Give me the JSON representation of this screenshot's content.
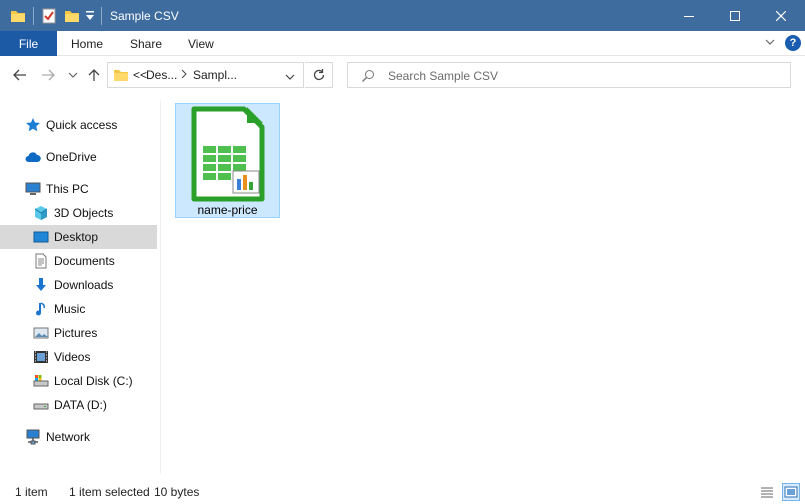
{
  "window": {
    "title": "Sample CSV"
  },
  "ribbon": {
    "tabs": [
      "File",
      "Home",
      "Share",
      "View"
    ]
  },
  "address": {
    "overflow": "<<",
    "segments": [
      "Des...",
      "Sampl..."
    ]
  },
  "search": {
    "placeholder": "Search Sample CSV"
  },
  "sidebar": {
    "items": [
      {
        "label": "Quick access",
        "icon": "star-icon"
      },
      {
        "label": "OneDrive",
        "icon": "cloud-icon"
      },
      {
        "label": "This PC",
        "icon": "computer-icon"
      },
      {
        "label": "3D Objects",
        "icon": "cube-icon"
      },
      {
        "label": "Desktop",
        "icon": "desktop-icon",
        "selected": true
      },
      {
        "label": "Documents",
        "icon": "document-icon"
      },
      {
        "label": "Downloads",
        "icon": "download-icon"
      },
      {
        "label": "Music",
        "icon": "music-icon"
      },
      {
        "label": "Pictures",
        "icon": "picture-icon"
      },
      {
        "label": "Videos",
        "icon": "video-icon"
      },
      {
        "label": "Local Disk (C:)",
        "icon": "drive-icon"
      },
      {
        "label": "DATA (D:)",
        "icon": "drive-icon"
      },
      {
        "label": "Network",
        "icon": "network-icon"
      }
    ]
  },
  "files": [
    {
      "name": "name-price",
      "icon": "spreadsheet-icon",
      "selected": true
    }
  ],
  "status": {
    "count": "1 item",
    "selected": "1 item selected",
    "size": "10 bytes"
  },
  "colors": {
    "titlebar": "#3f6c9f",
    "file_tab": "#1c5aa6",
    "selection": "#cce8ff"
  }
}
